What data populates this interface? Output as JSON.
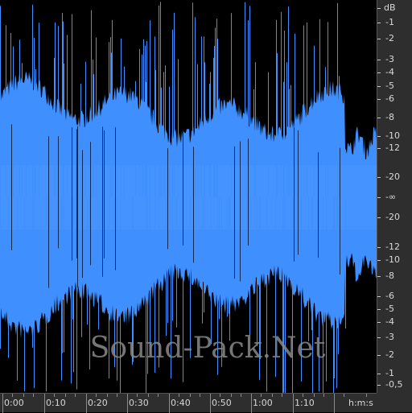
{
  "waveform": {
    "color": "#3f8fff",
    "background": "#000000",
    "center_label": "-∞"
  },
  "watermark": {
    "text": "Sound-Pack.Net"
  },
  "db_scale": {
    "unit": "dB",
    "upper": [
      "-1",
      "-2",
      "-3",
      "-4",
      "-5",
      "-6",
      "-8",
      "-10",
      "-12",
      "-20"
    ],
    "center": "-∞",
    "lower": [
      "-20",
      "-12",
      "-10",
      "-8",
      "-6",
      "-5",
      "-4",
      "-3",
      "-2",
      "-1",
      "-0,5"
    ]
  },
  "time_ruler": {
    "labels": [
      "0:00",
      "0:10",
      "0:20",
      "0:30",
      "0:40",
      "0:50",
      "1:00",
      "1:10"
    ],
    "unit": "h:m:s"
  }
}
